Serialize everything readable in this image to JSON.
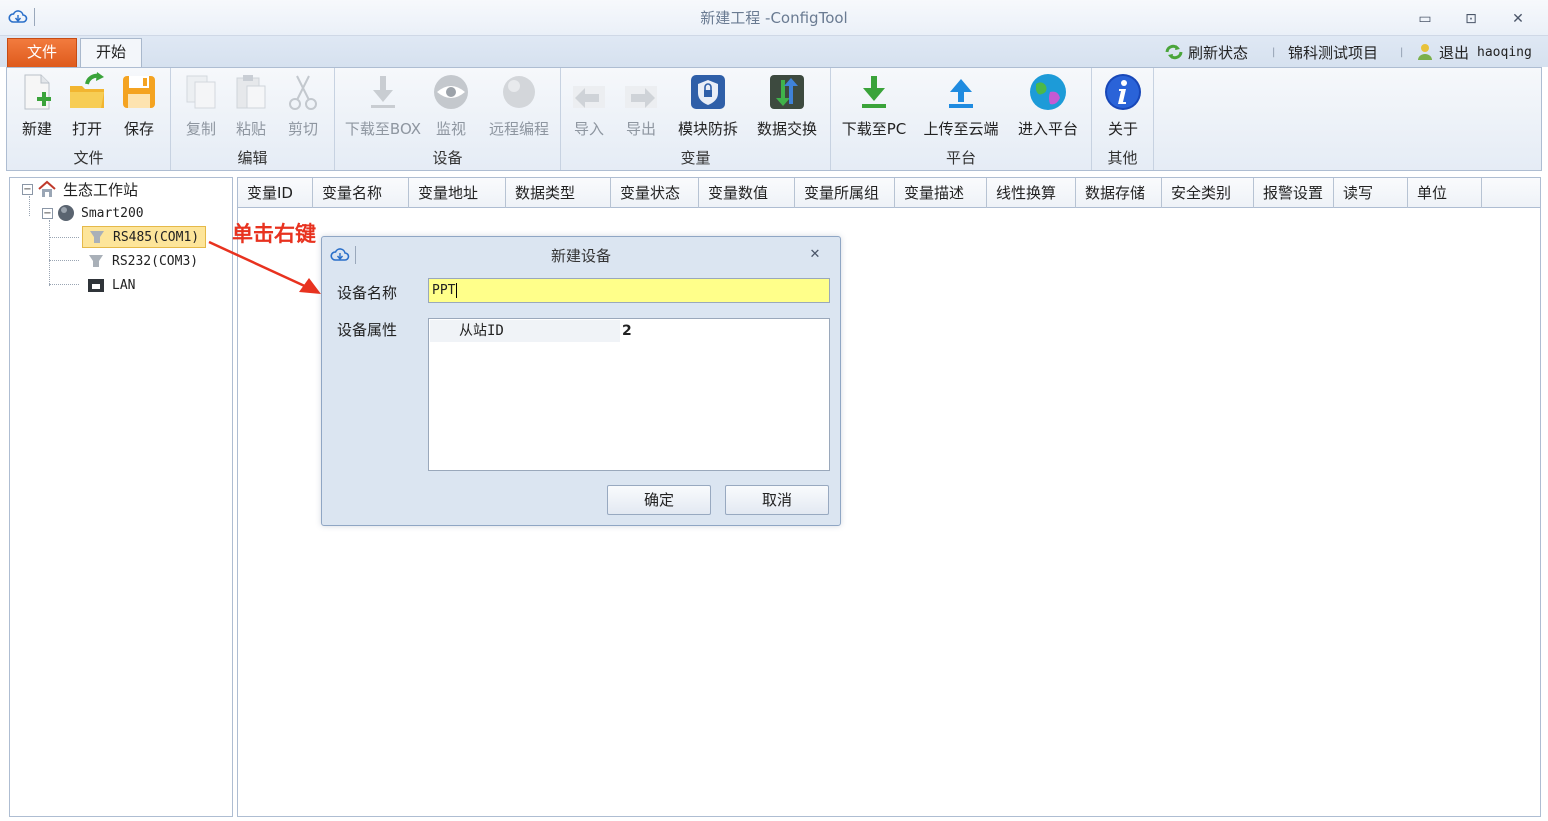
{
  "window": {
    "title": "新建工程 -ConfigTool",
    "controls": {
      "minimize": "▭",
      "restore": "⊡",
      "close": "✕"
    }
  },
  "ribbon_tabs": {
    "file": "文件",
    "start": "开始"
  },
  "top_right": {
    "refresh": "刷新状态",
    "project": "锦科测试项目",
    "logout": "退出",
    "user": "haoqing"
  },
  "ribbon": {
    "groups": {
      "file": "文件",
      "edit": "编辑",
      "device": "设备",
      "variable": "变量",
      "platform": "平台",
      "other": "其他"
    },
    "buttons": {
      "new": "新建",
      "open": "打开",
      "save": "保存",
      "copy": "复制",
      "paste": "粘贴",
      "cut": "剪切",
      "download_box": "下载至BOX",
      "monitor": "监视",
      "remote": "远程编程",
      "import": "导入",
      "export": "导出",
      "module_protect": "模块防拆",
      "data_exchange": "数据交换",
      "download_pc": "下载至PC",
      "upload_cloud": "上传至云端",
      "enter_platform": "进入平台",
      "about": "关于"
    }
  },
  "tree": {
    "root": "生态工作站",
    "device": "Smart200",
    "ports": [
      "RS485(COM1)",
      "RS232(COM3)",
      "LAN"
    ]
  },
  "grid": {
    "columns": [
      "变量ID",
      "变量名称",
      "变量地址",
      "数据类型",
      "变量状态",
      "变量数值",
      "变量所属组",
      "变量描述",
      "线性换算",
      "数据存储",
      "安全类别",
      "报警设置",
      "读写",
      "单位"
    ]
  },
  "annotation": {
    "text": "单击右键",
    "color": "#e8321f"
  },
  "dialog": {
    "title": "新建设备",
    "name_label": "设备名称",
    "name_value": "PPT",
    "props_label": "设备属性",
    "prop_key": "从站ID",
    "prop_value": "2",
    "ok": "确定",
    "cancel": "取消"
  },
  "colors": {
    "file_tab": "#e8642a",
    "selected_node": "#fde59a",
    "name_input_bg": "#ffff8a",
    "dialog_bg": "#dbe5f1"
  }
}
